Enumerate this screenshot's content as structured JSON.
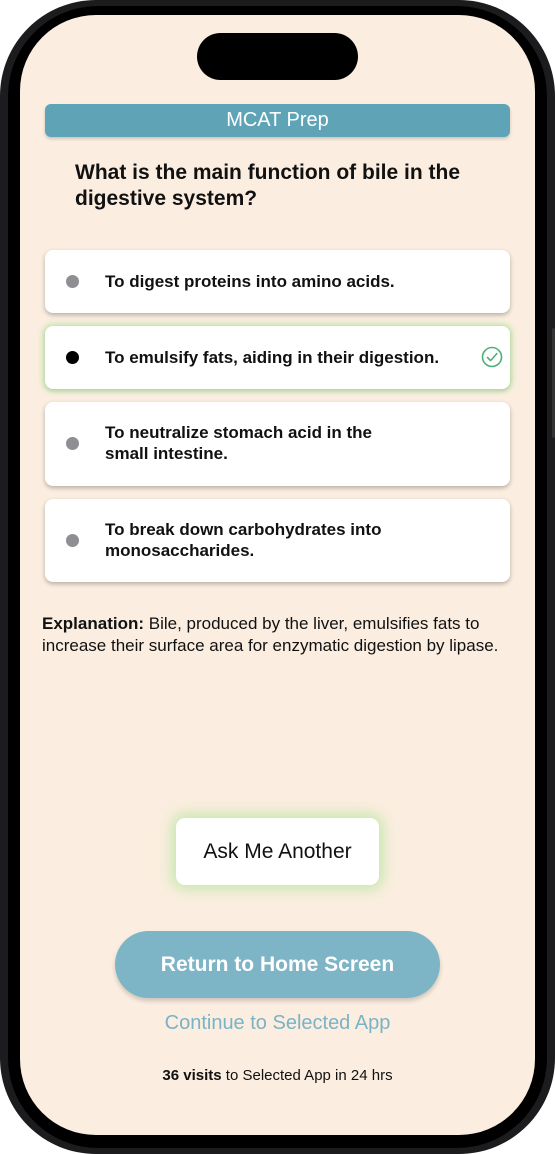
{
  "app": {
    "title": "MCAT Prep"
  },
  "question": {
    "text": "What is the main function of bile in the digestive system?"
  },
  "options": [
    {
      "label": "To digest proteins into amino acids.",
      "selected": false
    },
    {
      "label": "To emulsify fats, aiding in their digestion.",
      "selected": true,
      "icon": "checkmark-circle-icon"
    },
    {
      "label": "To neutralize stomach acid in the small intestine.",
      "selected": false
    },
    {
      "label": "To break down carbohydrates into monosaccharides.",
      "selected": false
    }
  ],
  "explanation": {
    "label": "Explanation:",
    "text": " Bile, produced by the liver, emulsifies fats to increase their surface area for enzymatic digestion by lipase."
  },
  "actions": {
    "ask_another": "Ask Me Another",
    "return_home": "Return to Home Screen",
    "continue_app": "Continue to Selected App"
  },
  "footer": {
    "visits_count": "36 visits",
    "visits_text": " to Selected App in 24 hrs"
  },
  "colors": {
    "background": "#fbeee0",
    "header": "#5ea4b6",
    "primary_button": "#7eb5c6",
    "link": "#7ab3c6",
    "correct_glow": "#8cdc82",
    "check": "#4caf7a"
  }
}
